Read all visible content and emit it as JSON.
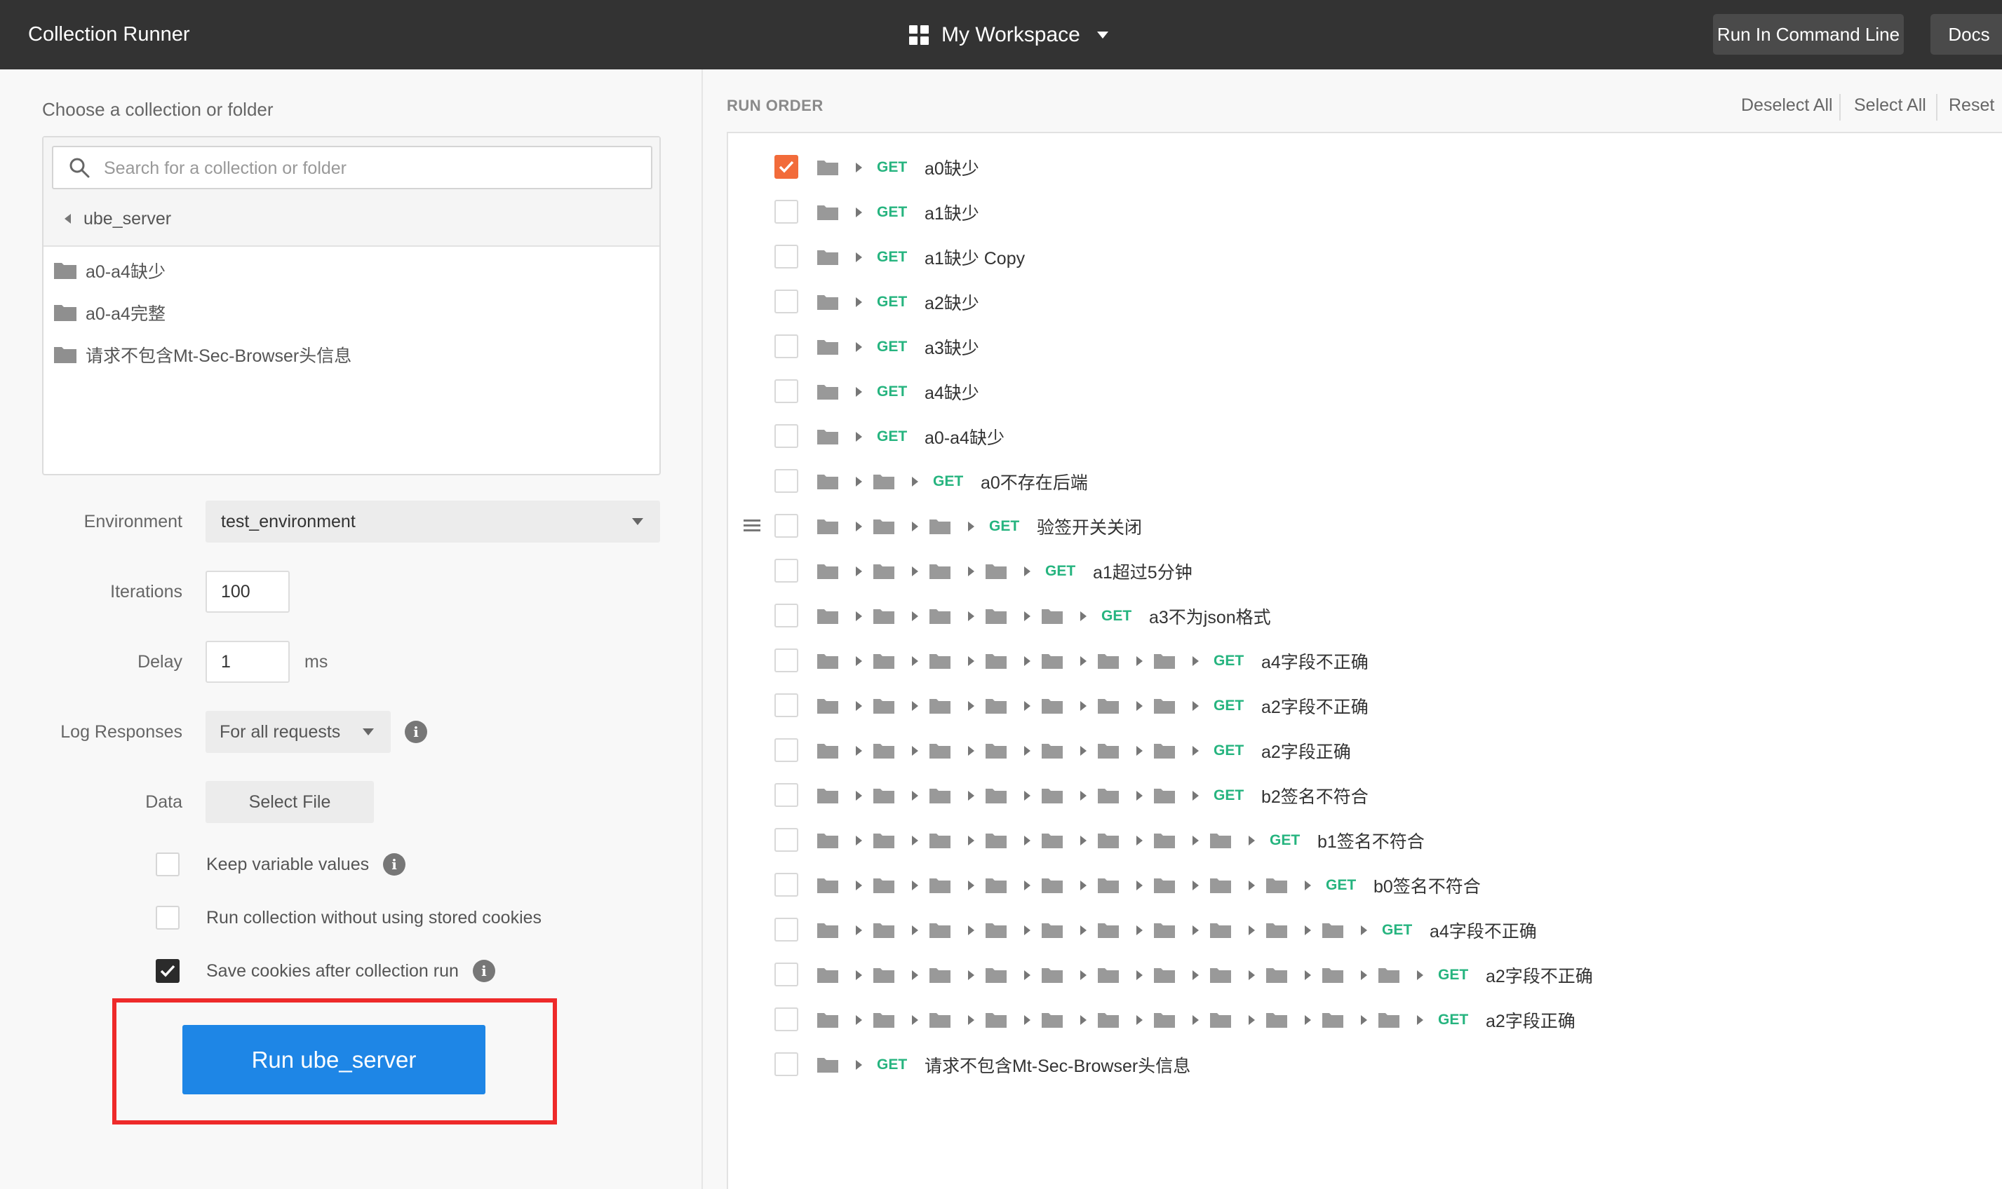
{
  "topbar": {
    "title": "Collection Runner",
    "workspace": "My Workspace",
    "run_cmd": "Run In Command Line",
    "docs": "Docs"
  },
  "left": {
    "choose_label": "Choose a collection or folder",
    "search_placeholder": "Search for a collection or folder",
    "breadcrumb": "ube_server",
    "folders": [
      "a0-a4缺少",
      "a0-a4完整",
      "请求不包含Mt-Sec-Browser头信息"
    ],
    "environment_label": "Environment",
    "environment_value": "test_environment",
    "iterations_label": "Iterations",
    "iterations_value": "100",
    "delay_label": "Delay",
    "delay_value": "1",
    "delay_unit": "ms",
    "log_label": "Log Responses",
    "log_value": "For all requests",
    "data_label": "Data",
    "select_file": "Select File",
    "options": [
      {
        "label": "Keep variable values",
        "checked": false,
        "info": true
      },
      {
        "label": "Run collection without using stored cookies",
        "checked": false,
        "info": false
      },
      {
        "label": "Save cookies after collection run",
        "checked": true,
        "info": true
      }
    ],
    "run_button": "Run ube_server"
  },
  "right": {
    "run_order_label": "RUN ORDER",
    "deselect_all": "Deselect All",
    "select_all": "Select All",
    "reset": "Reset",
    "method": "GET",
    "requests": [
      {
        "depth": 1,
        "name": "a0缺少",
        "checked": true
      },
      {
        "depth": 1,
        "name": "a1缺少",
        "checked": false
      },
      {
        "depth": 1,
        "name": "a1缺少 Copy",
        "checked": false
      },
      {
        "depth": 1,
        "name": "a2缺少",
        "checked": false
      },
      {
        "depth": 1,
        "name": "a3缺少",
        "checked": false
      },
      {
        "depth": 1,
        "name": "a4缺少",
        "checked": false
      },
      {
        "depth": 1,
        "name": "a0-a4缺少",
        "checked": false
      },
      {
        "depth": 2,
        "name": "a0不存在后端",
        "checked": false
      },
      {
        "depth": 3,
        "name": "验签开关关闭",
        "checked": false,
        "handle": true
      },
      {
        "depth": 4,
        "name": "a1超过5分钟",
        "checked": false
      },
      {
        "depth": 5,
        "name": "a3不为json格式",
        "checked": false
      },
      {
        "depth": 7,
        "name": "a4字段不正确",
        "checked": false
      },
      {
        "depth": 7,
        "name": "a2字段不正确",
        "checked": false
      },
      {
        "depth": 7,
        "name": "a2字段正确",
        "checked": false
      },
      {
        "depth": 7,
        "name": "b2签名不符合",
        "checked": false
      },
      {
        "depth": 8,
        "name": "b1签名不符合",
        "checked": false
      },
      {
        "depth": 9,
        "name": "b0签名不符合",
        "checked": false
      },
      {
        "depth": 10,
        "name": "a4字段不正确",
        "checked": false
      },
      {
        "depth": 11,
        "name": "a2字段不正确",
        "checked": false
      },
      {
        "depth": 11,
        "name": "a2字段正确",
        "checked": false
      },
      {
        "depth": 1,
        "name": "请求不包含Mt-Sec-Browser头信息",
        "checked": false
      }
    ]
  },
  "colors": {
    "topbar": "#333333",
    "accent_blue": "#1e86e6",
    "get_green": "#26b47f",
    "checked_orange": "#f26b3a",
    "highlight_red": "#ee2a2a"
  }
}
